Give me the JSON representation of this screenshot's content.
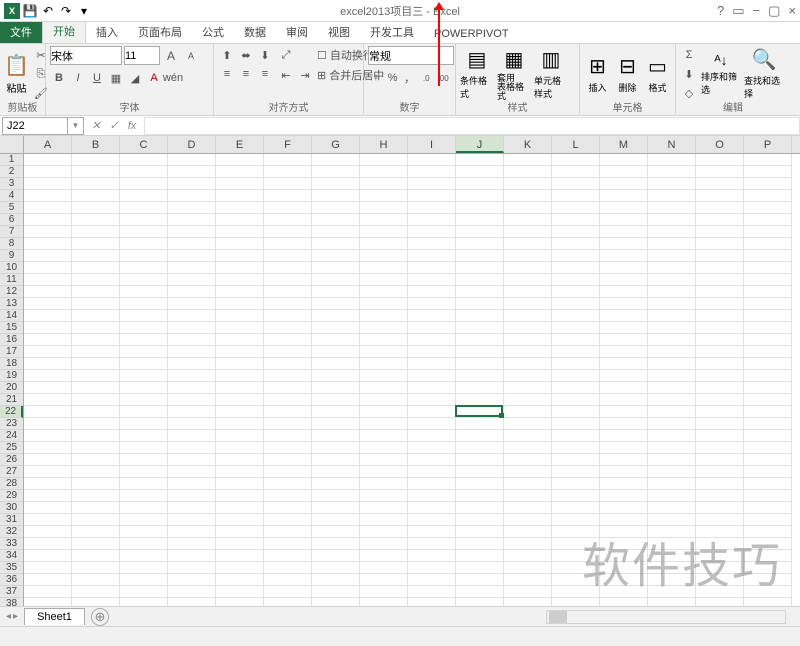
{
  "title": "excel2013项目三 - Excel",
  "qat": {
    "save_icon": "💾",
    "undo_icon": "↶",
    "redo_icon": "↷",
    "dd_icon": "▾"
  },
  "title_controls": {
    "help": "?",
    "full": "▭",
    "minimize": "−",
    "restore": "▢",
    "close": "×"
  },
  "tabs": {
    "file": "文件",
    "home": "开始",
    "insert": "插入",
    "pagelayout": "页面布局",
    "formulas": "公式",
    "data": "数据",
    "review": "审阅",
    "view": "视图",
    "dev": "开发工具",
    "powerpivot": "POWERPIVOT"
  },
  "ribbon": {
    "clipboard": {
      "paste": "粘贴",
      "label": "剪贴板"
    },
    "font": {
      "name": "宋体",
      "size": "11",
      "bold": "B",
      "italic": "I",
      "underline": "U",
      "grow": "A",
      "shrink": "A",
      "label": "字体"
    },
    "align": {
      "wrap": "自动换行",
      "merge": "合并后居中",
      "label": "对齐方式"
    },
    "number": {
      "format": "常规",
      "currency": "♀",
      "percent": "%",
      "comma": "，",
      "incdec": ".0",
      "decdec": ".00",
      "label": "数字"
    },
    "styles": {
      "cond": "条件格式",
      "table": "套用\n表格格式",
      "cell": "单元格样式",
      "label": "样式"
    },
    "cells": {
      "insert": "插入",
      "delete": "删除",
      "format": "格式",
      "label": "单元格"
    },
    "editing": {
      "sum": "Σ",
      "fill": "⬇",
      "clear": "◇",
      "sort": "排序和筛选",
      "find": "查找和选择",
      "label": "编辑"
    }
  },
  "namebox": "J22",
  "fx": "fx",
  "columns": [
    "A",
    "B",
    "C",
    "D",
    "E",
    "F",
    "G",
    "H",
    "I",
    "J",
    "K",
    "L",
    "M",
    "N",
    "O",
    "P"
  ],
  "active": {
    "col": "J",
    "row": 22,
    "colIndex": 9,
    "rowIndex": 21
  },
  "rows_count": 40,
  "sheet": {
    "tab1": "Sheet1",
    "add": "⊕"
  },
  "watermark": "软件技巧"
}
